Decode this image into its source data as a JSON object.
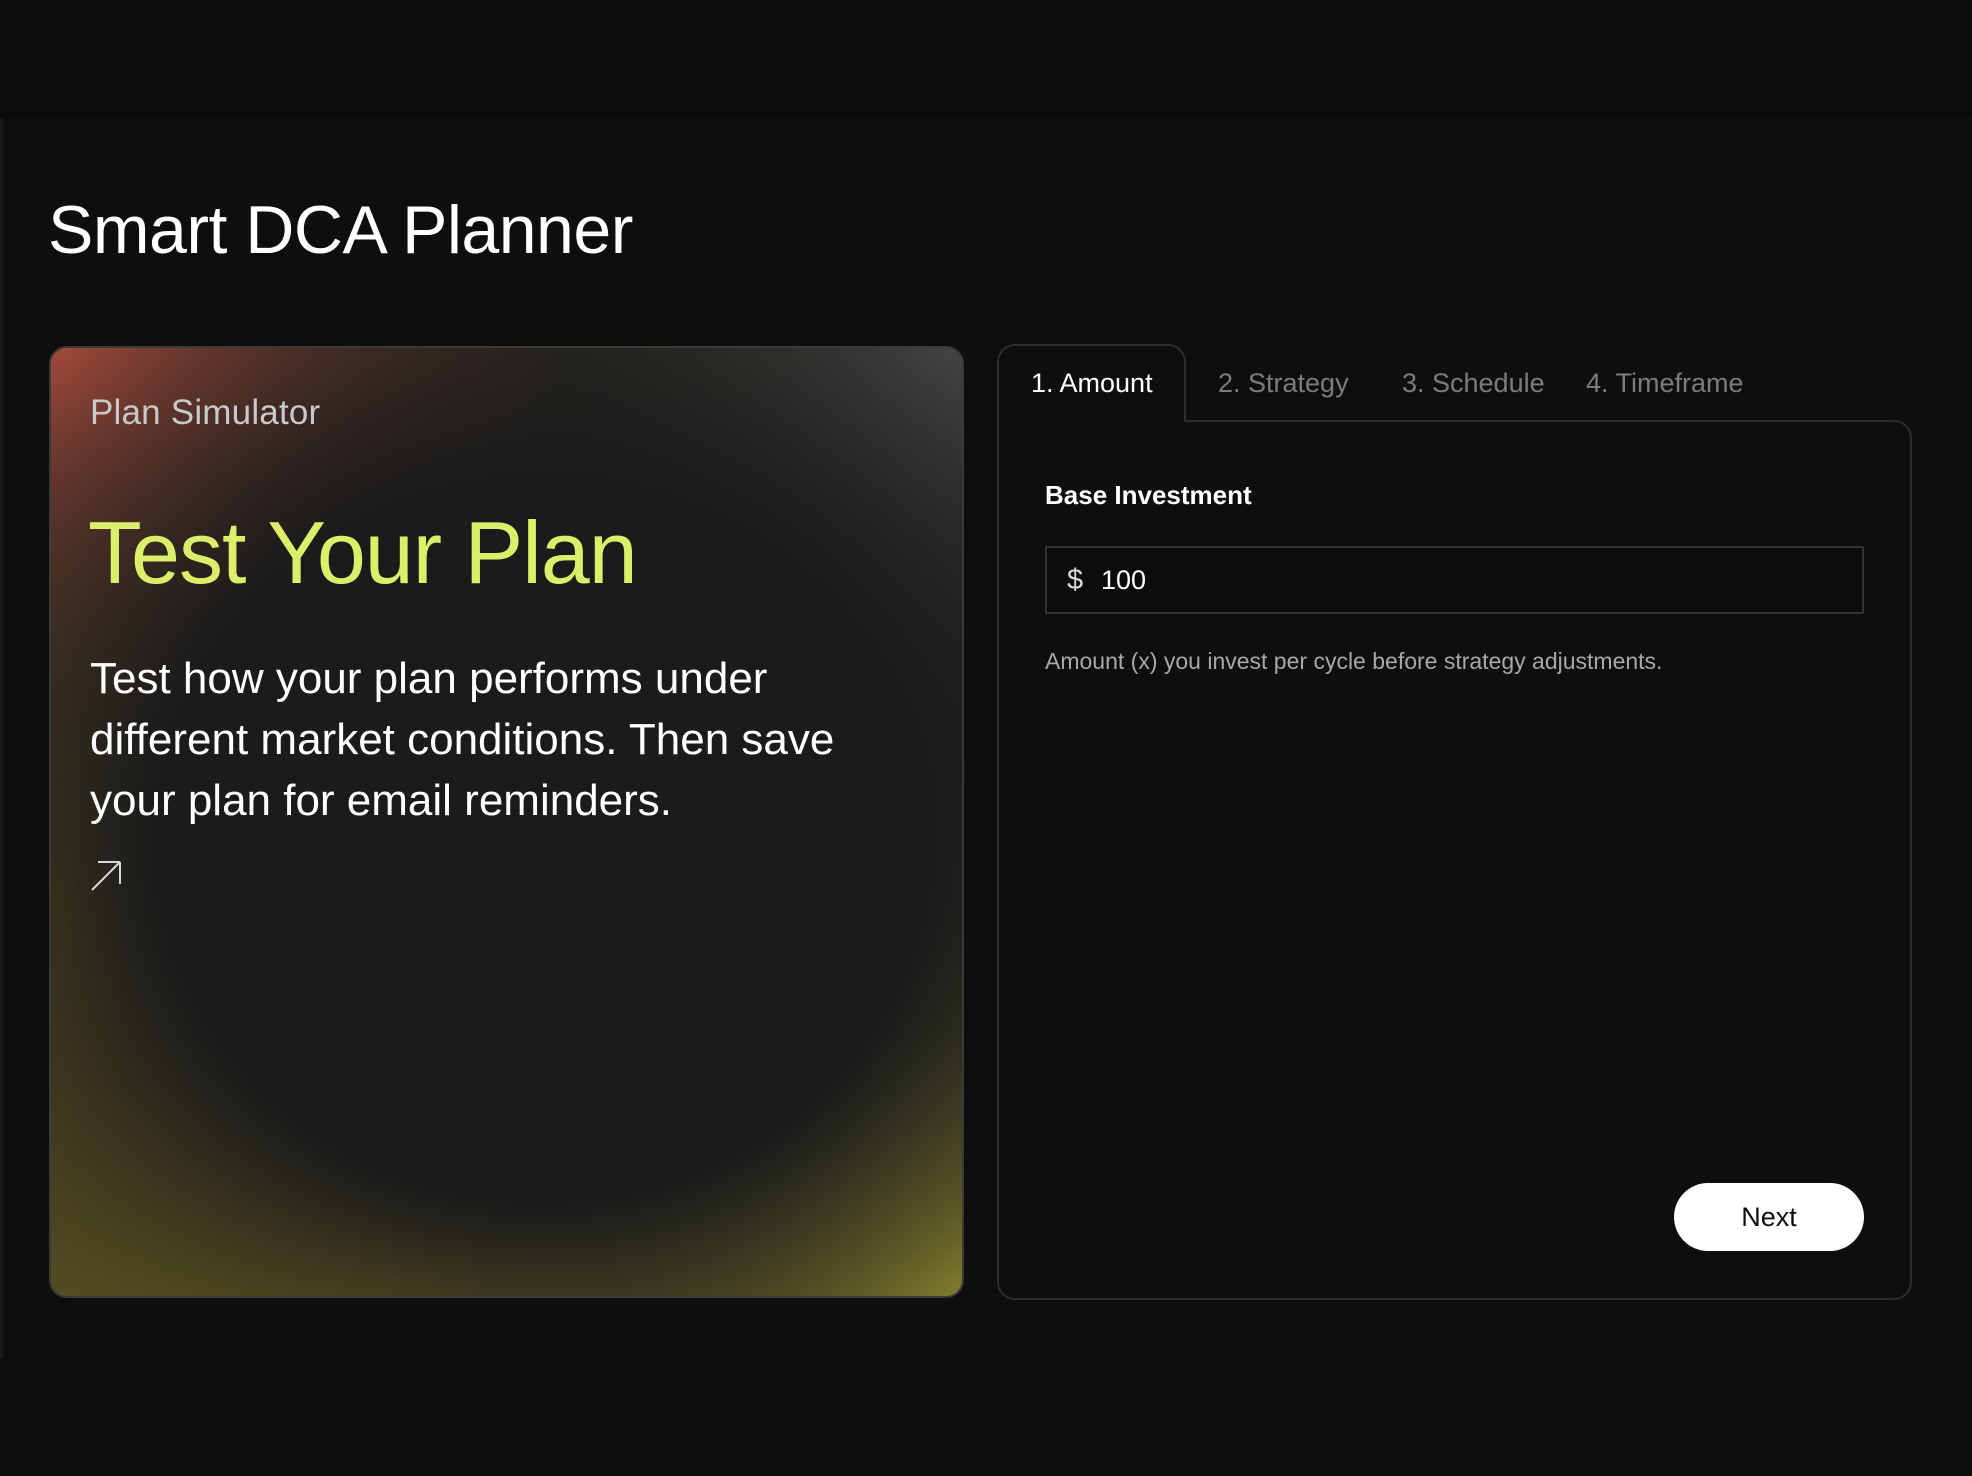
{
  "page": {
    "title": "Smart DCA Planner"
  },
  "promo": {
    "eyebrow": "Plan Simulator",
    "heading": "Test Your Plan",
    "body": "Test how your plan performs under different market conditions. Then save your plan for email reminders.",
    "link_icon": "arrow-up-right-icon"
  },
  "tabs": [
    {
      "label": "1. Amount",
      "active": true
    },
    {
      "label": "2. Strategy",
      "active": false
    },
    {
      "label": "3. Schedule",
      "active": false
    },
    {
      "label": "4. Timeframe",
      "active": false
    }
  ],
  "form": {
    "field_label": "Base Investment",
    "currency_symbol": "$",
    "value": "100",
    "helper": "Amount (x) you invest per cycle before strategy adjustments.",
    "next_label": "Next"
  },
  "colors": {
    "background": "#0e0e0e",
    "accent": "#dcef6a",
    "button_bg": "#ffffff",
    "muted_text": "#7c7c7c"
  }
}
